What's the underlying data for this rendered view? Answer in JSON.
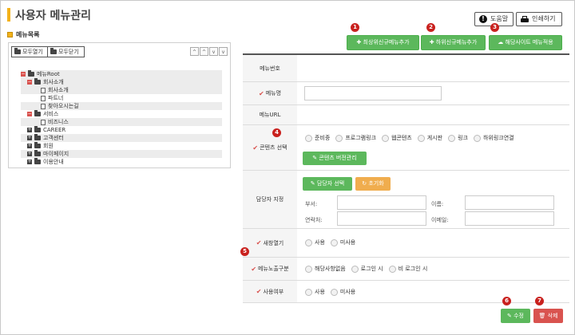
{
  "page": {
    "title": "사용자 메뉴관리"
  },
  "toolbar": {
    "help_label": "도움말",
    "help_icon": "exclamation-circle-icon",
    "print_label": "인쇄하기",
    "print_icon": "printer-icon"
  },
  "left": {
    "section_label": "메뉴목록",
    "expand_all": "모두열기",
    "collapse_all": "모두닫기",
    "nav_arrows": [
      "^",
      "^",
      "v",
      "v"
    ],
    "tree": [
      {
        "label": "메뉴Root",
        "level": 0,
        "toggle": "minus",
        "kind": "folder",
        "shade": true
      },
      {
        "label": "회사소개",
        "level": 1,
        "toggle": "minus",
        "kind": "folder",
        "shade": true
      },
      {
        "label": "회사소개",
        "level": 2,
        "toggle": "",
        "kind": "doc",
        "shade": true
      },
      {
        "label": "파트너",
        "level": 2,
        "toggle": "",
        "kind": "doc",
        "shade": false
      },
      {
        "label": "찾아오시는길",
        "level": 2,
        "toggle": "",
        "kind": "doc",
        "shade": true
      },
      {
        "label": "서비스",
        "level": 1,
        "toggle": "minus",
        "kind": "folder",
        "shade": false
      },
      {
        "label": "비즈니스",
        "level": 2,
        "toggle": "",
        "kind": "doc",
        "shade": true
      },
      {
        "label": "CAREER",
        "level": 1,
        "toggle": "plus",
        "kind": "folder",
        "shade": false
      },
      {
        "label": "고객센터",
        "level": 1,
        "toggle": "plus",
        "kind": "folder",
        "shade": true
      },
      {
        "label": "회원",
        "level": 1,
        "toggle": "plus",
        "kind": "folder",
        "shade": false
      },
      {
        "label": "마이페이지",
        "level": 1,
        "toggle": "plus",
        "kind": "folder",
        "shade": true
      },
      {
        "label": "이용안내",
        "level": 1,
        "toggle": "plus",
        "kind": "folder",
        "shade": false
      }
    ]
  },
  "actions": {
    "add_top": "✚ 최상위신규메뉴추가",
    "add_sub": "✚ 하위신규메뉴추가",
    "apply_site": "☁ 해당사이트 메뉴적용"
  },
  "form": {
    "menu_no": {
      "label": "메뉴번호",
      "value": ""
    },
    "menu_name": {
      "label": "메뉴명",
      "value": ""
    },
    "menu_url": {
      "label": "메뉴URL",
      "value": ""
    },
    "content": {
      "label": "콘텐츠 선택",
      "options": [
        "준비중",
        "프로그램링크",
        "웹콘텐츠",
        "게시판",
        "링크",
        "하위링크연결"
      ],
      "version_button": "✎ 콘텐츠 버전관리"
    },
    "manager": {
      "label": "담당자 지정",
      "select_button": "✎ 담당자 선택",
      "reset_button": "↻ 초기화",
      "dept_label": "부서:",
      "name_label": "이름:",
      "contact_label": "연락처:",
      "email_label": "이메일:"
    },
    "new_window": {
      "label": "새창열기",
      "options": [
        "사용",
        "미사용"
      ]
    },
    "menu_expose": {
      "label": "메뉴노출구분",
      "options": [
        "해당사항없음",
        "로그인 시",
        "비 로그인 시"
      ]
    },
    "use_status": {
      "label": "사용여부",
      "options": [
        "사용",
        "미사용"
      ]
    }
  },
  "bottom": {
    "edit": "✎ 수정",
    "delete": "🗑 삭제"
  },
  "markers": [
    "1",
    "2",
    "3",
    "4",
    "5",
    "6",
    "7"
  ],
  "colors": {
    "green": "#5cb85c",
    "orange": "#f0ad4e",
    "red": "#d9534f",
    "marker": "#c9211e",
    "accent": "#f3b21b"
  }
}
